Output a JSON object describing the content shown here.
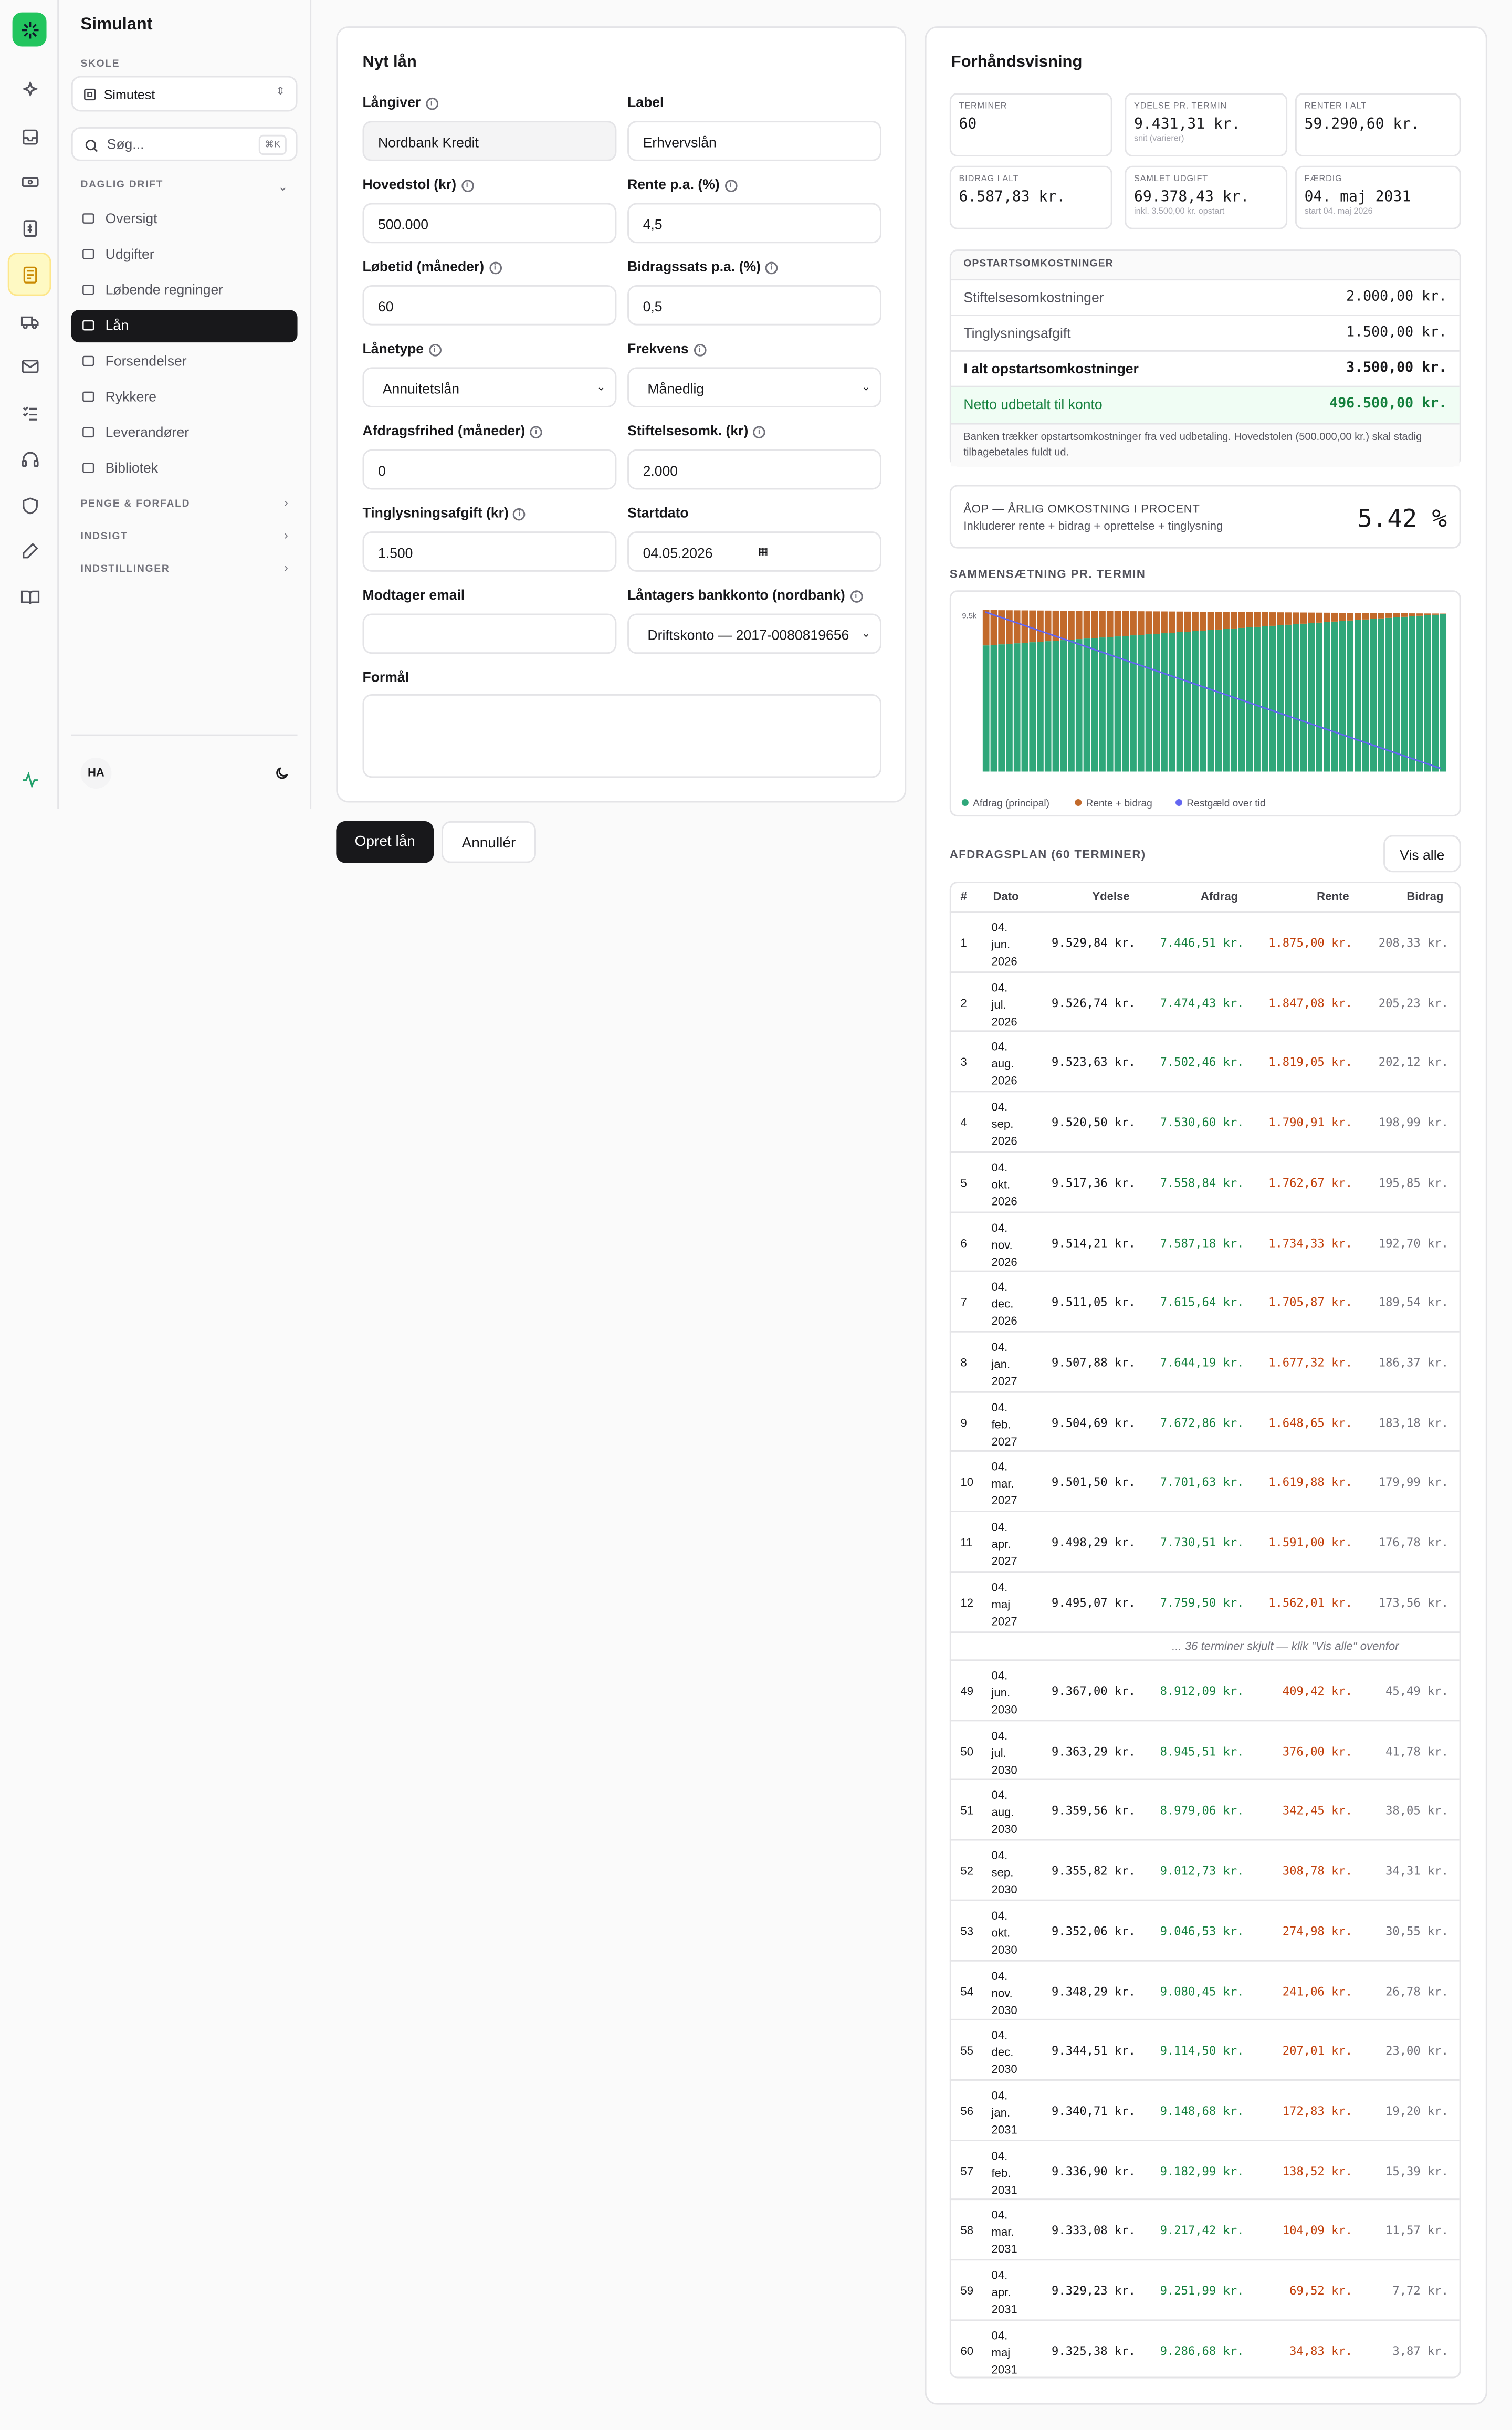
{
  "app": {
    "title": "Simulant"
  },
  "workspace": {
    "label": "SKOLE",
    "value": "Simutest"
  },
  "search": {
    "placeholder": "Søg...",
    "shortcut": "⌘K"
  },
  "nav": {
    "section_daily": "DAGLIG DRIFT",
    "items": [
      {
        "label": "Oversigt",
        "icon": "grid-icon"
      },
      {
        "label": "Udgifter",
        "icon": "receipt-icon"
      },
      {
        "label": "Løbende regninger",
        "icon": "file-icon"
      },
      {
        "label": "Lån",
        "icon": "banknote-icon"
      },
      {
        "label": "Forsendelser",
        "icon": "truck-icon"
      },
      {
        "label": "Rykkere",
        "icon": "mail-icon"
      },
      {
        "label": "Leverandører",
        "icon": "building-icon"
      },
      {
        "label": "Bibliotek",
        "icon": "book-icon"
      }
    ],
    "section_money": "PENGE & FORFALD",
    "section_insight": "INDSIGT",
    "section_settings": "INDSTILLINGER"
  },
  "user": {
    "initials": "HA"
  },
  "form": {
    "title": "Nyt lån",
    "langiver": {
      "label": "Långiver",
      "value": "Nordbank Kredit"
    },
    "label": {
      "label": "Label",
      "value": "Erhvervslån"
    },
    "hovedstol": {
      "label": "Hovedstol (kr)",
      "value": "500.000"
    },
    "rente": {
      "label": "Rente p.a. (%)",
      "value": "4,5"
    },
    "lobetid": {
      "label": "Løbetid (måneder)",
      "value": "60"
    },
    "bidrag": {
      "label": "Bidragssats p.a. (%)",
      "value": "0,5"
    },
    "lanetype": {
      "label": "Lånetype",
      "value": "Annuitetslån"
    },
    "frekvens": {
      "label": "Frekvens",
      "value": "Månedlig"
    },
    "afdragsfrihed": {
      "label": "Afdragsfrihed (måneder)",
      "value": "0"
    },
    "stiftelse": {
      "label": "Stiftelsesomk. (kr)",
      "value": "2.000"
    },
    "tinglysning": {
      "label": "Tinglysningsafgift (kr)",
      "value": "1.500"
    },
    "startdato": {
      "label": "Startdato",
      "value": "04.05.2026"
    },
    "email": {
      "label": "Modtager email",
      "value": ""
    },
    "bankkonto": {
      "label": "Låntagers bankkonto (nordbank)",
      "value": "Driftskonto — 2017-0080819656"
    },
    "formal": {
      "label": "Formål",
      "value": ""
    },
    "submit": "Opret lån",
    "cancel": "Annullér"
  },
  "preview": {
    "title": "Forhåndsvisning",
    "stats": [
      {
        "label": "TERMINER",
        "value": "60",
        "sub": ""
      },
      {
        "label": "YDELSE PR. TERMIN",
        "value": "9.431,31 kr.",
        "sub": "snit (varierer)"
      },
      {
        "label": "RENTER I ALT",
        "value": "59.290,60 kr.",
        "sub": ""
      },
      {
        "label": "BIDRAG I ALT",
        "value": "6.587,83 kr.",
        "sub": ""
      },
      {
        "label": "SAMLET UDGIFT",
        "value": "69.378,43 kr.",
        "sub": "inkl. 3.500,00 kr. opstart"
      },
      {
        "label": "FÆRDIG",
        "value": "04. maj 2031",
        "sub": "start 04. maj 2026"
      }
    ],
    "costs": {
      "title": "OPSTARTSOMKOSTNINGER",
      "rows": [
        {
          "label": "Stiftelsesomkostninger",
          "value": "2.000,00 kr."
        },
        {
          "label": "Tinglysningsafgift",
          "value": "1.500,00 kr."
        }
      ],
      "total": {
        "label": "I alt opstartsomkostninger",
        "value": "3.500,00 kr."
      },
      "net": {
        "label": "Netto udbetalt til konto",
        "value": "496.500,00 kr."
      },
      "note": "Banken trækker opstartsomkostninger fra ved udbetaling. Hovedstolen (500.000,00 kr.) skal stadig tilbagebetales fuldt ud."
    },
    "aop": {
      "title": "ÅOP — ÅRLIG OMKOSTNING I PROCENT",
      "sub": "Inkluderer rente + bidrag + oprettelse + tinglysning",
      "value": "5.42 %"
    },
    "composition_title": "SAMMENSÆTNING PR. TERMIN",
    "chart_ytick": "9.5k",
    "legend": {
      "afdrag": "Afdrag (principal)",
      "rente": "Rente + bidrag",
      "rest": "Restgæld over tid"
    },
    "colors": {
      "afdrag": "#2fa77a",
      "rente": "#c26a2b",
      "rest": "#6366f1"
    },
    "schedule": {
      "title": "AFDRAGSPLAN (60 TERMINER)",
      "show_all": "Vis alle",
      "headers": [
        "#",
        "Dato",
        "Ydelse",
        "Afdrag",
        "Rente",
        "Bidrag"
      ],
      "hidden_note": "... 36 terminer skjult — klik \"Vis alle\" ovenfor",
      "rows_top": [
        [
          "1",
          "04. jun. 2026",
          "9.529,84 kr.",
          "7.446,51 kr.",
          "1.875,00 kr.",
          "208,33 kr."
        ],
        [
          "2",
          "04. jul. 2026",
          "9.526,74 kr.",
          "7.474,43 kr.",
          "1.847,08 kr.",
          "205,23 kr."
        ],
        [
          "3",
          "04. aug. 2026",
          "9.523,63 kr.",
          "7.502,46 kr.",
          "1.819,05 kr.",
          "202,12 kr."
        ],
        [
          "4",
          "04. sep. 2026",
          "9.520,50 kr.",
          "7.530,60 kr.",
          "1.790,91 kr.",
          "198,99 kr."
        ],
        [
          "5",
          "04. okt. 2026",
          "9.517,36 kr.",
          "7.558,84 kr.",
          "1.762,67 kr.",
          "195,85 kr."
        ],
        [
          "6",
          "04. nov. 2026",
          "9.514,21 kr.",
          "7.587,18 kr.",
          "1.734,33 kr.",
          "192,70 kr."
        ],
        [
          "7",
          "04. dec. 2026",
          "9.511,05 kr.",
          "7.615,64 kr.",
          "1.705,87 kr.",
          "189,54 kr."
        ],
        [
          "8",
          "04. jan. 2027",
          "9.507,88 kr.",
          "7.644,19 kr.",
          "1.677,32 kr.",
          "186,37 kr."
        ],
        [
          "9",
          "04. feb. 2027",
          "9.504,69 kr.",
          "7.672,86 kr.",
          "1.648,65 kr.",
          "183,18 kr."
        ],
        [
          "10",
          "04. mar. 2027",
          "9.501,50 kr.",
          "7.701,63 kr.",
          "1.619,88 kr.",
          "179,99 kr."
        ],
        [
          "11",
          "04. apr. 2027",
          "9.498,29 kr.",
          "7.730,51 kr.",
          "1.591,00 kr.",
          "176,78 kr."
        ],
        [
          "12",
          "04. maj 2027",
          "9.495,07 kr.",
          "7.759,50 kr.",
          "1.562,01 kr.",
          "173,56 kr."
        ]
      ],
      "rows_bottom": [
        [
          "49",
          "04. jun. 2030",
          "9.367,00 kr.",
          "8.912,09 kr.",
          "409,42 kr.",
          "45,49 kr."
        ],
        [
          "50",
          "04. jul. 2030",
          "9.363,29 kr.",
          "8.945,51 kr.",
          "376,00 kr.",
          "41,78 kr."
        ],
        [
          "51",
          "04. aug. 2030",
          "9.359,56 kr.",
          "8.979,06 kr.",
          "342,45 kr.",
          "38,05 kr."
        ],
        [
          "52",
          "04. sep. 2030",
          "9.355,82 kr.",
          "9.012,73 kr.",
          "308,78 kr.",
          "34,31 kr."
        ],
        [
          "53",
          "04. okt. 2030",
          "9.352,06 kr.",
          "9.046,53 kr.",
          "274,98 kr.",
          "30,55 kr."
        ],
        [
          "54",
          "04. nov. 2030",
          "9.348,29 kr.",
          "9.080,45 kr.",
          "241,06 kr.",
          "26,78 kr."
        ],
        [
          "55",
          "04. dec. 2030",
          "9.344,51 kr.",
          "9.114,50 kr.",
          "207,01 kr.",
          "23,00 kr."
        ],
        [
          "56",
          "04. jan. 2031",
          "9.340,71 kr.",
          "9.148,68 kr.",
          "172,83 kr.",
          "19,20 kr."
        ],
        [
          "57",
          "04. feb. 2031",
          "9.336,90 kr.",
          "9.182,99 kr.",
          "138,52 kr.",
          "15,39 kr."
        ],
        [
          "58",
          "04. mar. 2031",
          "9.333,08 kr.",
          "9.217,42 kr.",
          "104,09 kr.",
          "11,57 kr."
        ],
        [
          "59",
          "04. apr. 2031",
          "9.329,23 kr.",
          "9.251,99 kr.",
          "69,52 kr.",
          "7,72 kr."
        ],
        [
          "60",
          "04. maj 2031",
          "9.325,38 kr.",
          "9.286,68 kr.",
          "34,83 kr.",
          "3,87 kr."
        ]
      ]
    }
  },
  "chart_data": {
    "type": "bar",
    "title": "SAMMENSÆTNING PR. TERMIN",
    "stacked": true,
    "ytick": "9.5k",
    "series": [
      {
        "name": "Afdrag (principal)",
        "values_start": 7446.51,
        "values_end": 9286.68
      },
      {
        "name": "Rente + bidrag",
        "values_start": 2083.33,
        "values_end": 38.7
      },
      {
        "name": "Restgæld over tid",
        "values_start": 492553.49,
        "values_end": 0
      }
    ],
    "periods": 60
  }
}
